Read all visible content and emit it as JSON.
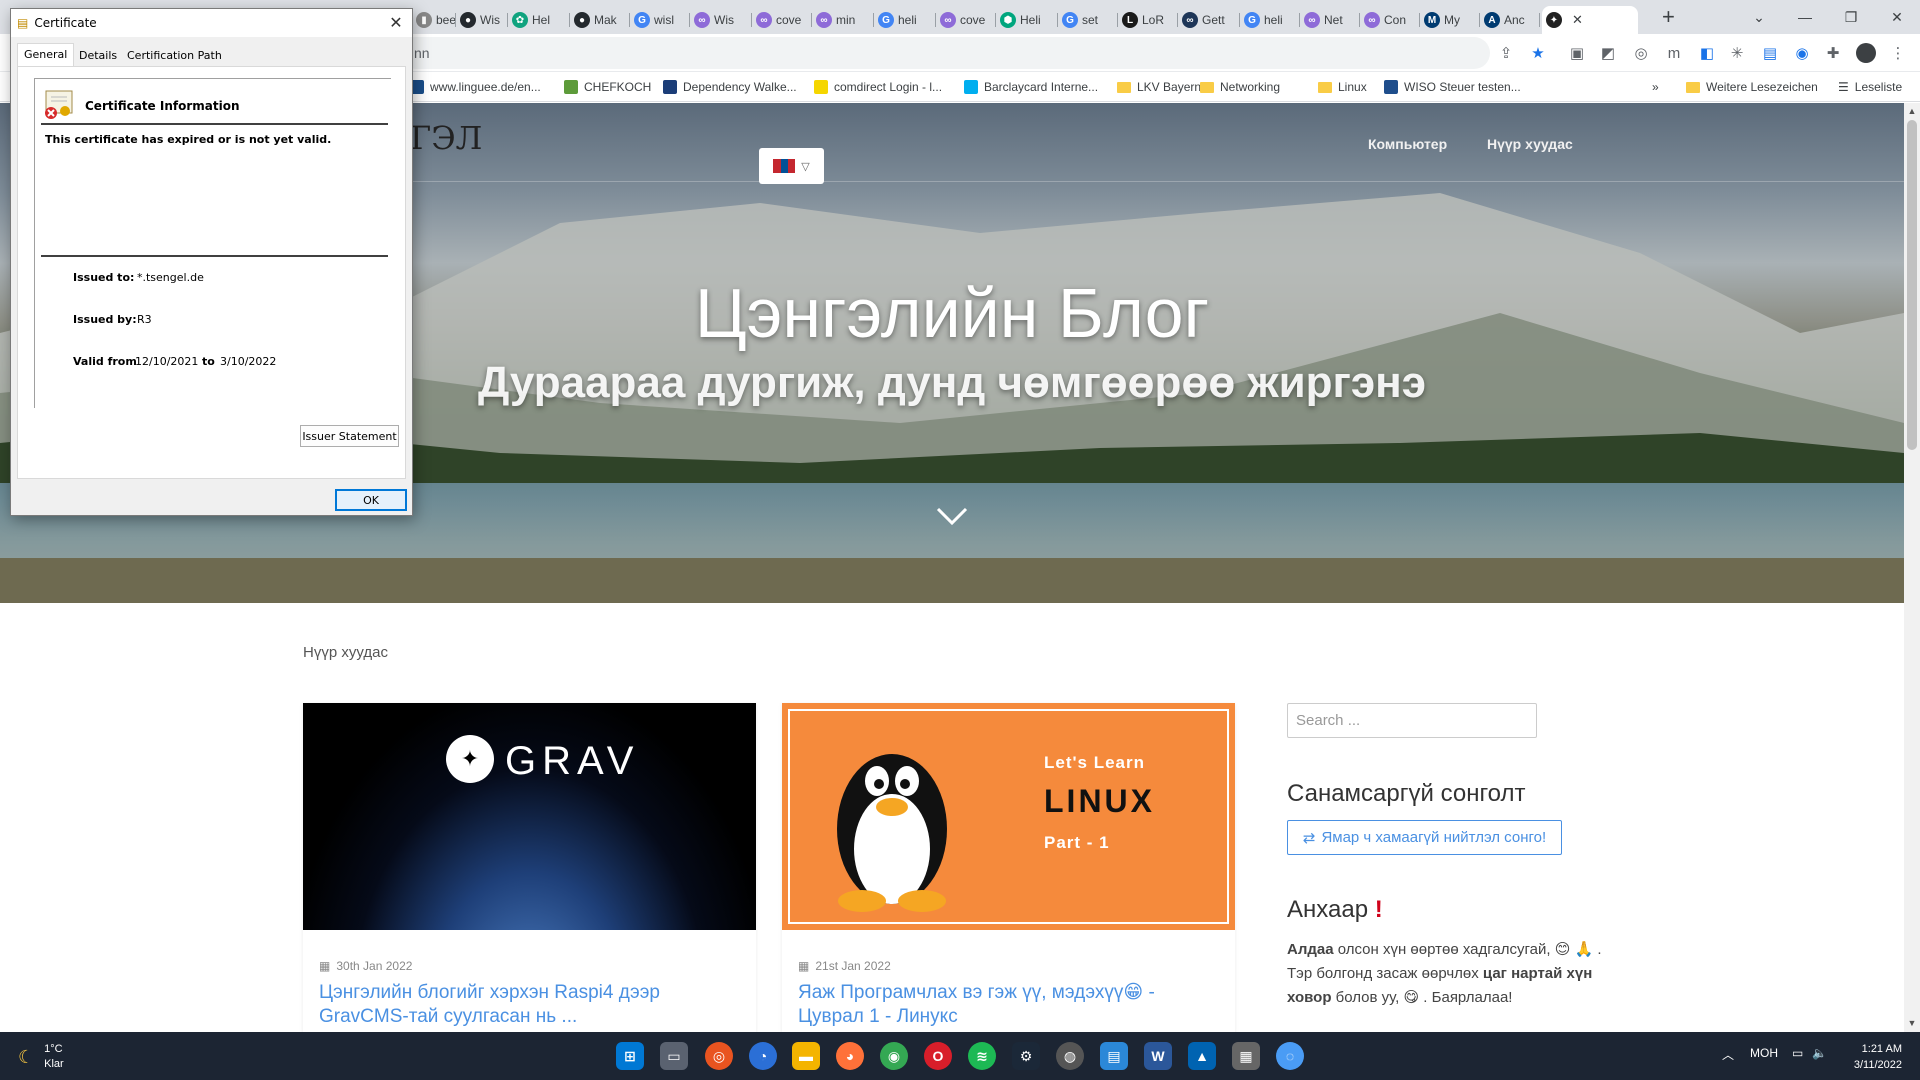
{
  "browser": {
    "tabs": [
      {
        "label": "bee",
        "icon": "bookmark-icon",
        "color": "#888888"
      },
      {
        "label": "Wis",
        "icon": "github-icon",
        "color": "#24292e"
      },
      {
        "label": "Hel",
        "icon": "chatgpt-icon",
        "color": "#10a37f"
      },
      {
        "label": "Mak",
        "icon": "github-icon",
        "color": "#24292e"
      },
      {
        "label": "wisl",
        "icon": "google-icon",
        "color": "#4285f4"
      },
      {
        "label": "Wis",
        "icon": "link-icon",
        "color": "#8e6bd8"
      },
      {
        "label": "cove",
        "icon": "link-icon",
        "color": "#8e6bd8"
      },
      {
        "label": "min",
        "icon": "link-icon",
        "color": "#8e6bd8"
      },
      {
        "label": "heli",
        "icon": "google-icon",
        "color": "#4285f4"
      },
      {
        "label": "cove",
        "icon": "link-icon",
        "color": "#8e6bd8"
      },
      {
        "label": "Heli",
        "icon": "hex-icon",
        "color": "#00a67e"
      },
      {
        "label": "set",
        "icon": "google-icon",
        "color": "#4285f4"
      },
      {
        "label": "LoR",
        "icon": "l-icon",
        "color": "#1a1a1a"
      },
      {
        "label": "Gett",
        "icon": "infinity-icon",
        "color": "#1d3557"
      },
      {
        "label": "heli",
        "icon": "google-icon",
        "color": "#4285f4"
      },
      {
        "label": "Net",
        "icon": "link-icon",
        "color": "#8e6bd8"
      },
      {
        "label": "Con",
        "icon": "link-icon",
        "color": "#8e6bd8"
      },
      {
        "label": "My",
        "icon": "m-icon",
        "color": "#003b71"
      },
      {
        "label": "Anc",
        "icon": "a-icon",
        "color": "#003b71"
      },
      {
        "label": "",
        "icon": "grav-icon",
        "color": "#222222",
        "active": true
      }
    ],
    "new_tab": "+",
    "omnibox_text": "nn",
    "bookmarks": [
      {
        "label": "www.linguee.de/en...",
        "color": "#1a4e8a"
      },
      {
        "label": "CHEFKOCH",
        "color": "#5d9b3a"
      },
      {
        "label": "Dependency Walke...",
        "color": "#1b3d78"
      },
      {
        "label": "comdirect Login - l...",
        "color": "#f5d600"
      },
      {
        "label": "Barclaycard Interne...",
        "color": "#00aeef"
      },
      {
        "label": "LKV Bayern",
        "color": "#f9cc46"
      },
      {
        "label": "Networking",
        "color": "#f9cc46"
      },
      {
        "label": "Linux",
        "color": "#f9cc46"
      },
      {
        "label": "WISO Steuer testen...",
        "color": "#1f4e8c"
      }
    ],
    "more_bookmarks": "»",
    "other_bookmarks": "Weitere Lesezeichen",
    "reading_list": "Leseliste"
  },
  "site": {
    "logo_partial": "ГЭЛ",
    "nav": [
      "Компьютер",
      "Нүүр хуудас"
    ],
    "hero_title": "Цэнгэлийн Блог",
    "hero_subtitle": "Дураараа дургиж, дунд чөмгөөрөө жиргэнэ",
    "breadcrumb": "Нүүр хуудас",
    "posts": [
      {
        "date": "30th Jan 2022",
        "title": "Цэнгэлийн блогийг хэрхэн Raspi4 дээр GravCMS-тай суулгасан нь ...",
        "image_text": "GRAV"
      },
      {
        "date": "21st Jan 2022",
        "title": "Яаж Програмчлах вэ гэж үү, мэдэхүү😁 - Цуврал 1 - Линукс",
        "image_text_1": "Let's Learn",
        "image_text_2": "LINUX",
        "image_text_3": "Part - 1"
      }
    ],
    "search_placeholder": "Search ...",
    "random_heading": "Санамсаргүй сонголт",
    "random_button": "Ямар ч хамаагүй нийтлэл сонго!",
    "notice_heading": "Анхаар",
    "notice_bold_1": "Алдаа",
    "notice_text_1": " олсон хүн өөртөө хадгалсугай, 😊 🙏 . Тэр болгонд засаж өөрчлөх ",
    "notice_bold_2": "цаг нартай хүн ховор",
    "notice_text_2": " болов уу, 😋 . Баярлалаа!"
  },
  "certificate": {
    "window_title": "Certificate",
    "tabs": [
      "General",
      "Details",
      "Certification Path"
    ],
    "info_title": "Certificate Information",
    "message": "This certificate has expired or is not yet valid.",
    "issued_to_label": "Issued to:",
    "issued_to": "*.tsengel.de",
    "issued_by_label": "Issued by:",
    "issued_by": "R3",
    "valid_from_label": "Valid from",
    "valid_from": "12/10/2021",
    "to_label": "to",
    "valid_to": "3/10/2022",
    "issuer_button": "Issuer Statement",
    "ok_button": "OK"
  },
  "taskbar": {
    "temperature": "1°C",
    "weather": "Klar",
    "language": "МОН",
    "time": "1:21 AM",
    "date": "3/11/2022"
  }
}
